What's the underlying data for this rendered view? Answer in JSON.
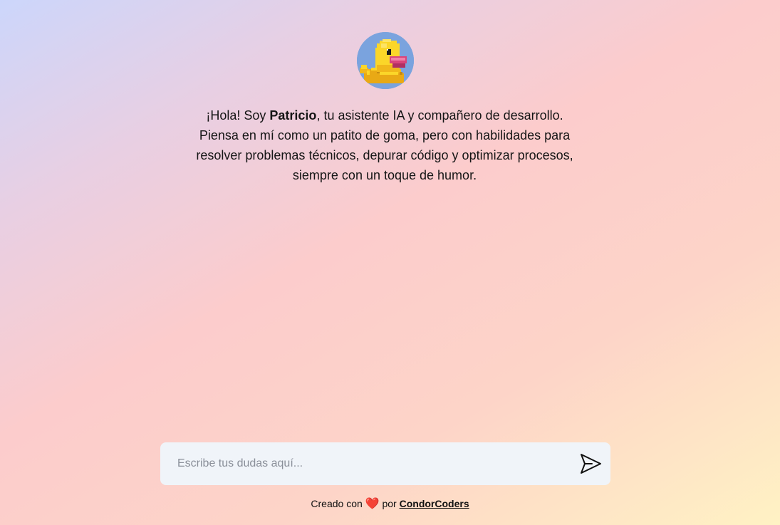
{
  "assistant": {
    "avatar_icon": "rubber-duck-icon",
    "greeting": "¡Hola! Soy ",
    "name": "Patricio",
    "intro_line1_rest": ", tu asistente IA y compañero de desarrollo.",
    "intro_line2": "Piensa en mí como un patito de goma, pero con habilidades para",
    "intro_line3": "resolver problemas técnicos, depurar código y optimizar procesos,",
    "intro_line4": "siempre con un toque de humor."
  },
  "chat": {
    "placeholder": "Escribe tus dudas aquí...",
    "value": "",
    "send_icon": "send-icon"
  },
  "footer": {
    "prefix": "Creado con ",
    "heart": "❤️",
    "middle": " por ",
    "link_label": "CondorCoders"
  },
  "colors": {
    "input_bg": "#f0f4f9",
    "heart": "#e0211d",
    "duck_yellow": "#fbd629",
    "avatar_bg": "#7aa3de"
  }
}
